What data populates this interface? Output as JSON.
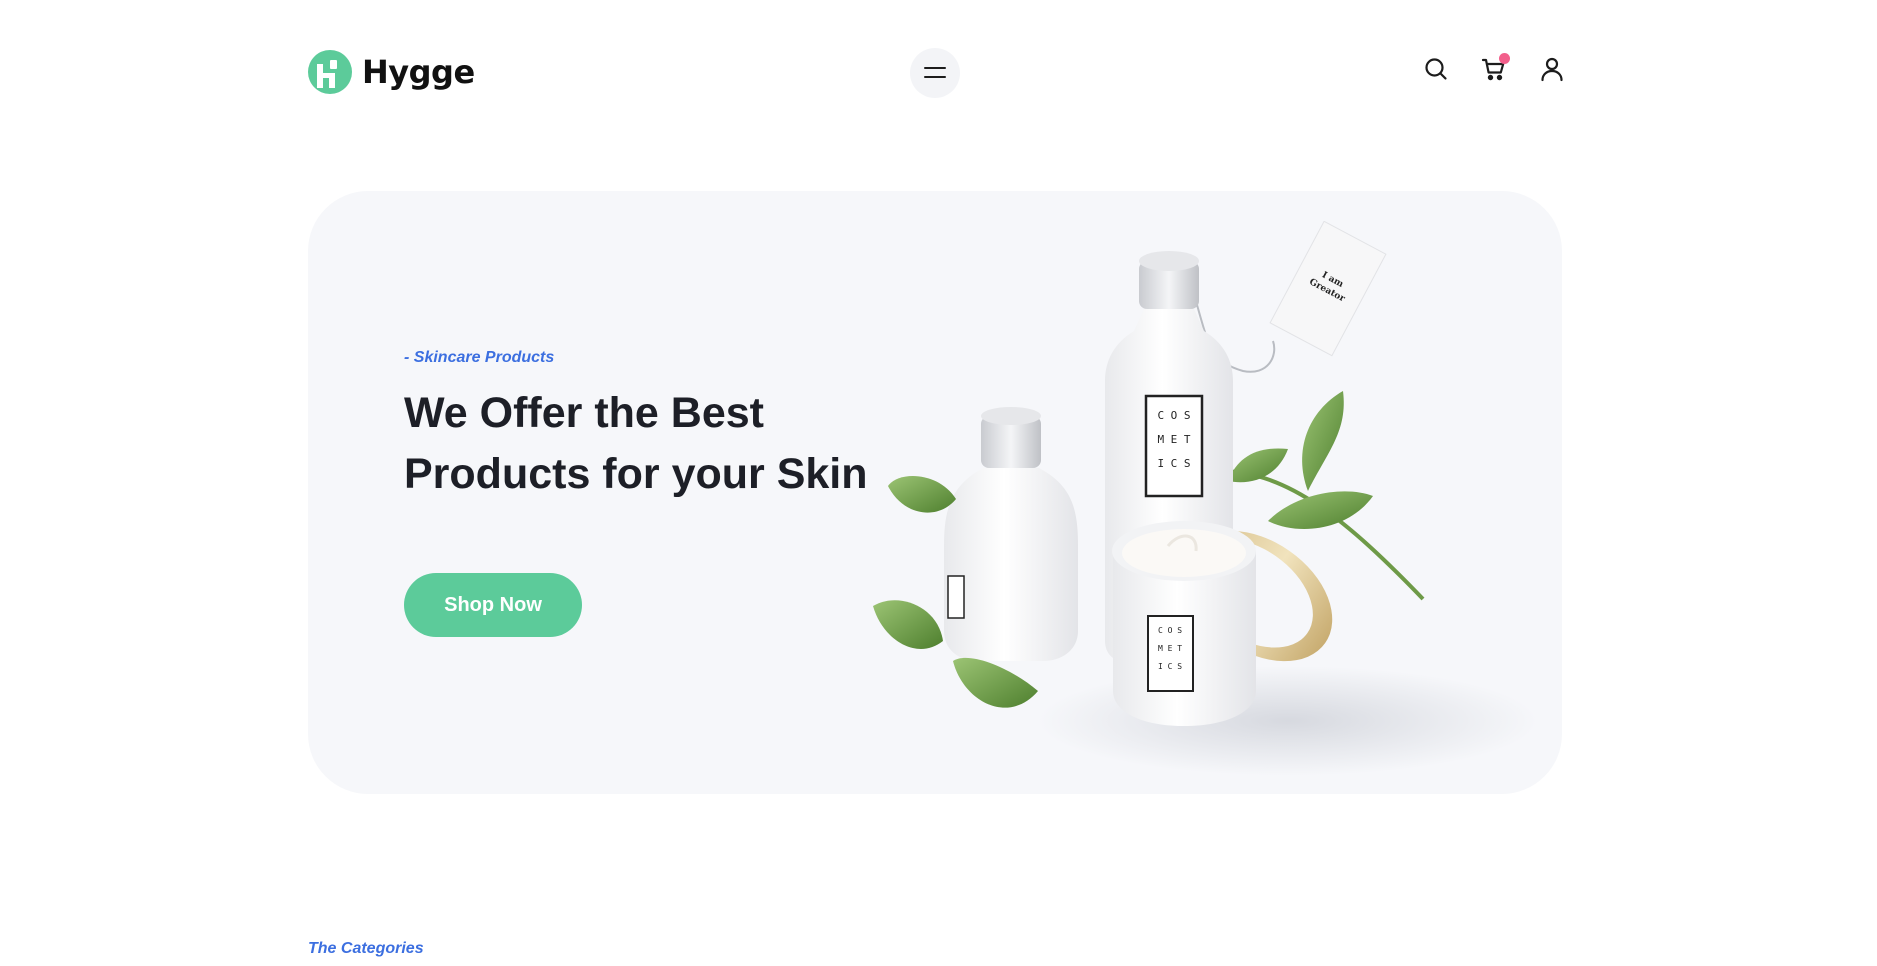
{
  "brand": {
    "name": "Hygge",
    "logo_icon": "hygge-logo-icon",
    "primary_color": "#5ccb9a"
  },
  "header": {
    "menu_icon": "hamburger-menu-icon",
    "actions": [
      {
        "name": "search",
        "icon": "search-icon"
      },
      {
        "name": "cart",
        "icon": "cart-icon",
        "has_notification": true
      },
      {
        "name": "account",
        "icon": "user-icon"
      }
    ],
    "notification_color": "#f25f8b"
  },
  "hero": {
    "eyebrow": "- Skincare Products",
    "title_lines": [
      "We Offer the Best",
      "Products for your Skin"
    ],
    "cta_label": "Shop Now",
    "accent_color": "#3c6fe0",
    "background_color": "#f6f7fa",
    "product_label": "COSMETICS",
    "tag_text": "I am Greator"
  },
  "categories": {
    "eyebrow": "The Categories"
  }
}
